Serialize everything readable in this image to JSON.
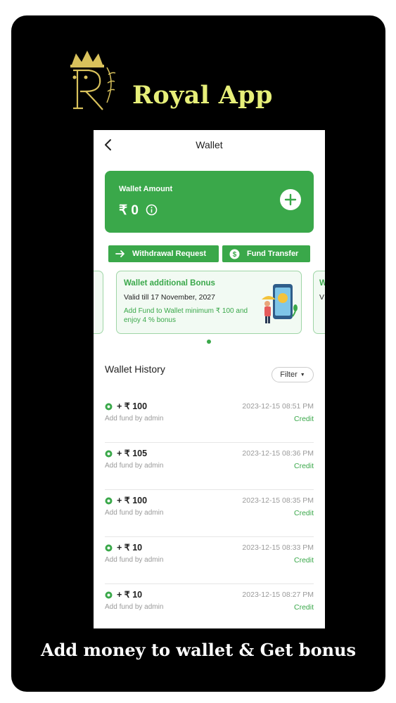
{
  "brand": {
    "name": "Royal App"
  },
  "tagline": "Add money to wallet & Get bonus",
  "header": {
    "title": "Wallet"
  },
  "wallet_card": {
    "label": "Wallet Amount",
    "amount": "₹ 0"
  },
  "actions": {
    "withdraw_label": "Withdrawal Request",
    "transfer_label": "Fund Transfer"
  },
  "bonus": {
    "title": "Wallet additional Bonus",
    "valid": "Valid till 17 November, 2027",
    "desc": "Add Fund to Wallet minimum ₹ 100 and enjoy 4 % bonus",
    "next_title_fragment": "W",
    "next_valid_fragment": "V"
  },
  "history": {
    "title": "Wallet History",
    "filter_label": "Filter",
    "items": [
      {
        "amount": "+ ₹ 100",
        "subtitle": "Add fund by admin",
        "datetime": "2023-12-15 08:51 PM",
        "type": "Credit"
      },
      {
        "amount": "+ ₹ 105",
        "subtitle": "Add fund by admin",
        "datetime": "2023-12-15 08:36 PM",
        "type": "Credit"
      },
      {
        "amount": "+ ₹ 100",
        "subtitle": "Add fund by admin",
        "datetime": "2023-12-15 08:35 PM",
        "type": "Credit"
      },
      {
        "amount": "+ ₹ 10",
        "subtitle": "Add fund by admin",
        "datetime": "2023-12-15 08:33 PM",
        "type": "Credit"
      },
      {
        "amount": "+ ₹ 10",
        "subtitle": "Add fund by admin",
        "datetime": "2023-12-15 08:27 PM",
        "type": "Credit"
      }
    ]
  },
  "colors": {
    "accent": "#3aa84a",
    "brand_text": "#e7ef79",
    "background": "#000000"
  },
  "icons": [
    "royal-logo-icon",
    "back-arrow-icon",
    "info-icon",
    "plus-icon",
    "arrow-right-icon",
    "dollar-circle-icon",
    "chevron-down-icon",
    "status-dot-icon",
    "bonus-illustration-icon"
  ]
}
